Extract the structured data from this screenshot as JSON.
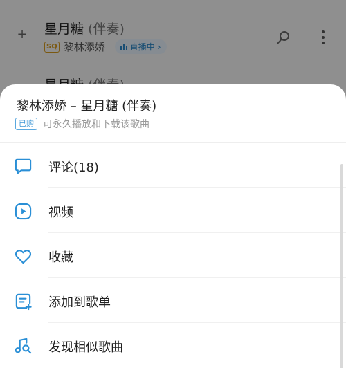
{
  "background_list": {
    "song1": {
      "title": "星月糖",
      "accompaniment": "(伴奏)",
      "quality_badge": "SQ",
      "artist": "黎林添娇",
      "live_label": "直播中"
    },
    "song2": {
      "title": "星月糖",
      "accompaniment": "(伴奏)"
    }
  },
  "sheet": {
    "title": "黎林添娇 – 星月糖 (伴奏)",
    "purchased_badge": "已购",
    "purchased_note": "可永久播放和下载该歌曲",
    "menu": [
      {
        "label": "评论(18)",
        "icon": "comment-icon"
      },
      {
        "label": "视频",
        "icon": "video-play-icon"
      },
      {
        "label": "收藏",
        "icon": "heart-icon"
      },
      {
        "label": "添加到歌单",
        "icon": "add-to-playlist-icon"
      },
      {
        "label": "发现相似歌曲",
        "icon": "similar-songs-icon"
      }
    ]
  },
  "colors": {
    "accent": "#2a8fd6",
    "sq_badge": "#d59a1e"
  }
}
